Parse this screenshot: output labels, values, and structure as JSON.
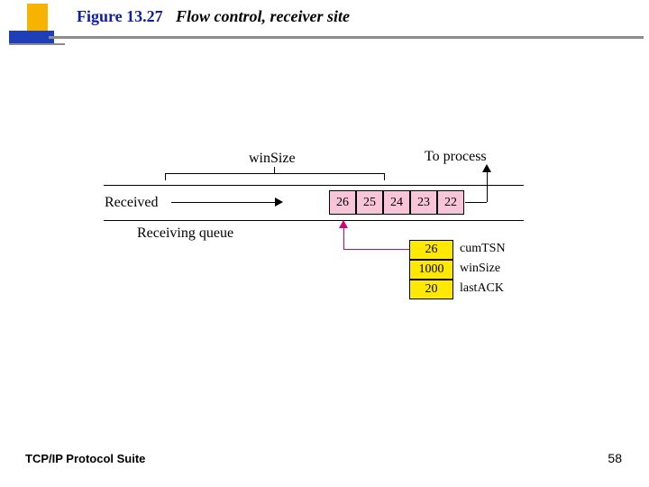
{
  "header": {
    "figure_number": "Figure 13.27",
    "figure_caption": "Flow control, receiver site"
  },
  "diagram": {
    "winsize_label": "winSize",
    "to_process_label": "To process",
    "received_label": "Received",
    "queue_label": "Receiving queue",
    "queue_values": [
      "26",
      "25",
      "24",
      "23",
      "22"
    ],
    "state": [
      {
        "value": "26",
        "label": "cumTSN"
      },
      {
        "value": "1000",
        "label": "winSize"
      },
      {
        "value": "20",
        "label": "lastACK"
      }
    ]
  },
  "footer": {
    "title": "TCP/IP Protocol Suite",
    "page": "58"
  }
}
